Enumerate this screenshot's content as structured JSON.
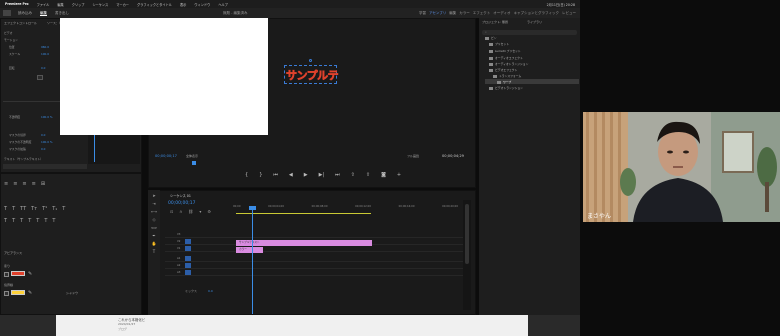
{
  "menubar": {
    "app": "Premiere Pro",
    "items": [
      "ファイル",
      "編集",
      "クリップ",
      "シーケンス",
      "マーカー",
      "グラフィックとタイトル",
      "表示",
      "ウィンドウ",
      "ヘルプ"
    ],
    "clock": "2月11日(日) 20:28"
  },
  "header": {
    "tabs": [
      "読み込み",
      "編集",
      "書き出し"
    ],
    "active_tab": "編集",
    "project_title": "無題 - 編集済み",
    "workspaces": [
      "学習",
      "アセンブリ",
      "編集",
      "カラー",
      "エフェクト",
      "オーディオ",
      "キャプションとグラフィック",
      "レビュー"
    ],
    "active_workspace": "アセンブリ"
  },
  "effect_controls": {
    "tab": "エフェクトコントロール",
    "tab2": "ソース：（クリップなし）",
    "clip_label": "グラフィック",
    "rows": [
      {
        "label": "ビデオ",
        "value": ""
      },
      {
        "label": "モーション",
        "value": ""
      },
      {
        "label": "位置",
        "value": "960.0"
      },
      {
        "label": "スケール",
        "value": "100.0"
      },
      {
        "label": "回転",
        "value": "0.0"
      },
      {
        "label": "不透明度",
        "value": "100.0 %"
      },
      {
        "label": "テキスト（サンプルテキスト）",
        "value": ""
      },
      {
        "label": "マスクの境界",
        "value": "0.0"
      },
      {
        "label": "マスクの不透明度",
        "value": "100.0 %"
      },
      {
        "label": "マスクの拡張",
        "value": "0.0"
      }
    ]
  },
  "essential_graphics": {
    "section": "アピアランス",
    "fill_label": "塗り",
    "stroke_label": "境界線",
    "shadow_label": "シャドウ",
    "fill_color": "#e0412c",
    "stroke_color": "#ffd23a"
  },
  "program": {
    "tab": "プログラム: シーケンス 01",
    "timecode_left": "00;00;00;17",
    "timecode_right": "00;00;04;29",
    "fit": "全体表示",
    "quality": "フル画質",
    "title_text": "サンプルテ",
    "transport": [
      "⏮",
      "⏪",
      "◀",
      "▶",
      "▶|",
      "⏩",
      "⏭",
      "+"
    ]
  },
  "timeline": {
    "tab": "シーケンス 01",
    "timecode": "00;00;00;17",
    "ruler": [
      "00;00",
      "00;00;04;00",
      "00;00;08;00",
      "00;00;12;00",
      "00;00;16;00",
      "00;00;20;00"
    ],
    "tracks": [
      "V3",
      "V2",
      "V1",
      "A1",
      "A2",
      "A3"
    ],
    "mix_label": "ミックス",
    "mix_value": "0.0",
    "clip_v2": "サンプルテキスト",
    "clip_v1": "カラー"
  },
  "project": {
    "tab": "プロジェクト: 無題",
    "tab2": "ライブラリ",
    "search_placeholder": "検索",
    "items": [
      {
        "label": "ビン",
        "indent": 0
      },
      {
        "label": "プリセット",
        "indent": 1
      },
      {
        "label": "Lumetri プリセット",
        "indent": 1
      },
      {
        "label": "オーディオエフェクト",
        "indent": 1
      },
      {
        "label": "オーディオトランジション",
        "indent": 1
      },
      {
        "label": "ビデオエフェクト",
        "indent": 1
      },
      {
        "label": "トランスフォーム",
        "indent": 2
      },
      {
        "label": "ワープ",
        "indent": 3
      },
      {
        "label": "ビデオトランジション",
        "indent": 1
      }
    ]
  },
  "taskbar": {
    "title": "これから本格化ビ",
    "date": "2024/01/27",
    "sub": "ブログ"
  },
  "webcam": {
    "name": "まさやん"
  }
}
